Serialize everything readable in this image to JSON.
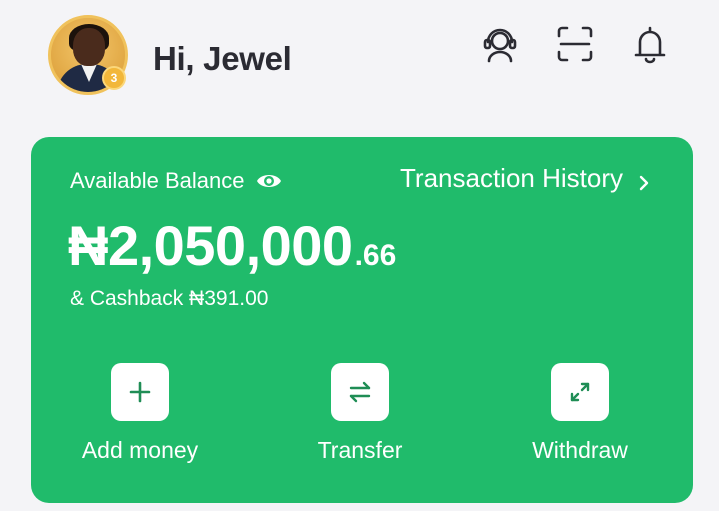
{
  "header": {
    "greeting": "Hi, Jewel",
    "avatar_badge": "3",
    "icons": [
      "support-agent-icon",
      "scan-icon",
      "notification-bell-icon"
    ]
  },
  "balance_card": {
    "label": "Available Balance",
    "history_link": "Transaction History",
    "amount_main": "₦2,050,000",
    "amount_decimal": ".66",
    "cashback": "& Cashback ₦391.00",
    "actions": [
      {
        "label": "Add money",
        "icon": "plus-icon"
      },
      {
        "label": "Transfer",
        "icon": "transfer-arrows-icon"
      },
      {
        "label": "Withdraw",
        "icon": "expand-arrows-icon"
      }
    ]
  },
  "colors": {
    "background": "#f4f4f7",
    "card_green": "#20bb6b",
    "text_dark": "#2b2b33",
    "badge_gold": "#f2b73a"
  }
}
